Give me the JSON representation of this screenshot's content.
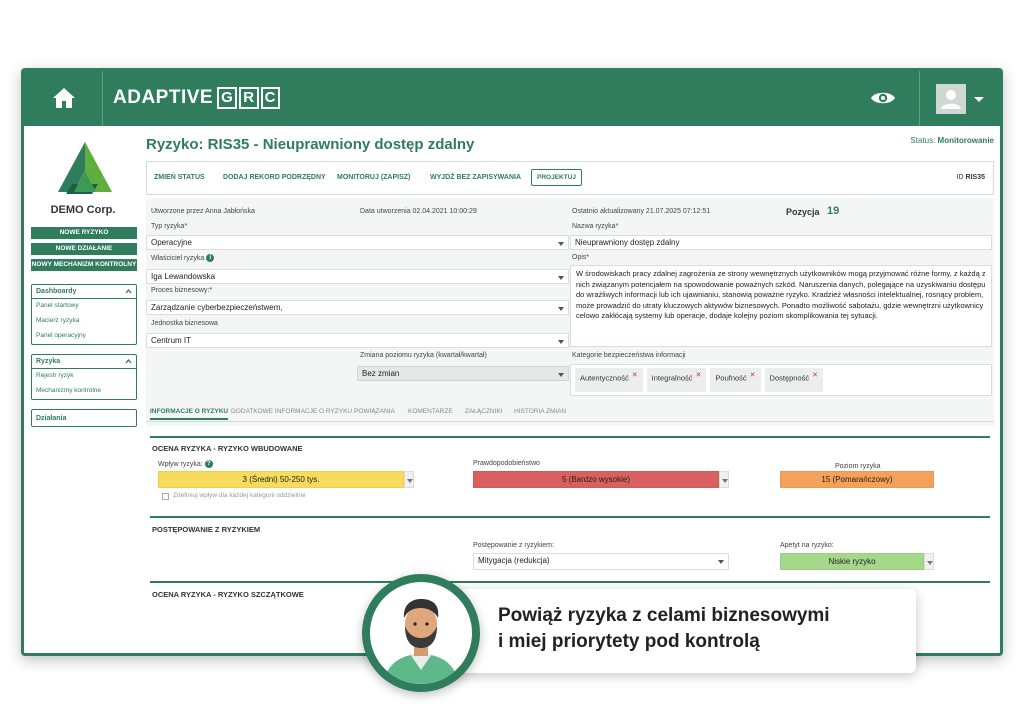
{
  "brand": {
    "name": "ADAPTIVE",
    "grc": [
      "G",
      "R",
      "C"
    ]
  },
  "sidebar": {
    "company": "DEMO Corp.",
    "buttons": [
      "NOWE RYZYKO",
      "NOWE DZIAŁANIE",
      "NOWY MECHANIZM KONTROLNY"
    ],
    "groups": [
      {
        "title": "Dashboardy",
        "items": [
          "Panel startowy",
          "Macierz ryzyka",
          "Panel operacyjny"
        ]
      },
      {
        "title": "Ryzyka",
        "items": [
          "Rejestr ryzyk",
          "Mechanizmy kontrolne"
        ]
      },
      {
        "title": "Działania",
        "items": []
      }
    ]
  },
  "header": {
    "title": "Ryzyko: RIS35 - Nieuprawniony dostęp zdalny",
    "status_label": "Status:",
    "status_value": "Monitorowanie",
    "actions": [
      "ZMIEŃ STATUS",
      "DODAJ REKORD PODRZĘDNY",
      "MONITORUJ (ZAPISZ)",
      "WYJDŹ BEZ ZAPISYWANIA",
      "PROJEKTUJ"
    ],
    "id_label": "ID",
    "id_value": "RIS35"
  },
  "form": {
    "created_by": "Utworzone przez Anna Jabłońska",
    "created_date": "Data utworzenia 02.04.2021 10:00:29",
    "updated": "Ostatnio aktualizowany 21.07.2025 07:12:51",
    "position_label": "Pozycja",
    "position_value": "19",
    "risk_type_label": "Typ ryzyka*",
    "risk_type_value": "Operacyjne",
    "owner_label": "Właściciel ryzyka",
    "owner_value": "Iga Lewandowska",
    "process_label": "Proces biznesowy:*",
    "process_value": "Zarządzanie cyberbezpieczeństwem,",
    "unit_label": "Jednostka biznesowa",
    "unit_value": "Centrum IT",
    "name_label": "Nazwa ryzyka*",
    "name_value": "Nieuprawniony dostęp zdalny",
    "desc_label": "Opis*",
    "desc_value": "W środowiskach pracy zdalnej zagrożenia ze strony wewnętrznych użytkowników mogą przyjmować różne formy, z każdą z nich związanym potencjałem na spowodowanie poważnych szkód. Naruszenia danych, polegające na uzyskiwaniu dostępu do wrażliwych informacji lub ich ujawnianiu, stanowią poważne ryzyko. Kradzież własności intelektualnej, rosnący problem, może prowadzić do utraty kluczowych aktywów biznesowych. Ponadto możliwość sabotażu, gdzie wewnętrzni użytkownicy celowo zakłócają systemy lub operacje, dodaje kolejny poziom skomplikowania tej sytuacji.",
    "change_label": "Zmiana poziomu ryzyka (kwartał/kwartał)",
    "change_value": "Bez zmian",
    "categories_label": "Kategorie bezpieczeństwa informacji",
    "categories": [
      "Autentyczność",
      "Integralność",
      "Poufność",
      "Dostępność"
    ]
  },
  "tabs": [
    "INFORMACJE O RYZYKU",
    "DODATKOWE INFORMACJE O RYZYKU",
    "POWIĄZANIA",
    "KOMENTARZE",
    "ZAŁĄCZNIKI",
    "HISTORIA ZMIAN"
  ],
  "inherent": {
    "title": "OCENA RYZYKA - RYZYKO WBUDOWANE",
    "impact_label": "Wpływ ryzyka:",
    "impact_value": "3 (Średni) 50-250 tys.",
    "checkbox_label": "Zdefiniuj wpływ dla każdej kategorii oddzielnie",
    "prob_label": "Prawdopodobieństwo",
    "prob_value": "5 (Bardzo wysokie)",
    "level_label": "Poziom ryzyka",
    "level_value": "15 (Pomarańczowy)"
  },
  "treatment": {
    "title": "POSTĘPOWANIE Z RYZYKIEM",
    "treat_label": "Postępowanie z ryzykiem:",
    "treat_value": "Mitygacja (redukcja)",
    "appetite_label": "Apetyt na ryzyko:",
    "appetite_value": "Niskie ryzyko"
  },
  "residual": {
    "title": "OCENA RYZYKA - RYZYKO SZCZĄTKOWE"
  },
  "promo": {
    "line1": "Powiąż ryzyka z celami biznesowymi",
    "line2": "i miej priorytety pod kontrolą"
  },
  "colors": {
    "brand": "#2f7d5d",
    "impact": "#f7dc5c",
    "probability": "#d9605f",
    "level": "#f6a15a",
    "appetite": "#a6d88b"
  }
}
